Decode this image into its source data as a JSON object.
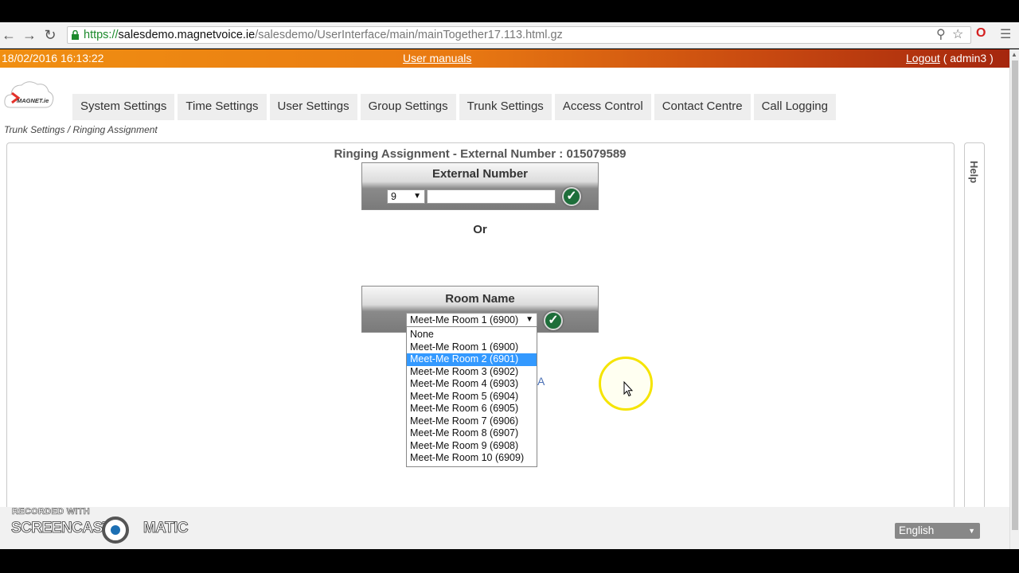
{
  "browser": {
    "url_protocol": "https://",
    "url_host": "salesdemo.magnetvoice.ie",
    "url_path": "/salesdemo/UserInterface/main/mainTogether17.113.html.gz"
  },
  "topbar": {
    "datetime": "18/02/2016  16:13:22",
    "user_manuals": "User manuals",
    "logout": "Logout",
    "user": " ( admin3 )"
  },
  "logo": {
    "text": "MAGNET.ie"
  },
  "menu": [
    "System Settings",
    "Time Settings",
    "User Settings",
    "Group Settings",
    "Trunk Settings",
    "Access Control",
    "Contact Centre",
    "Call Logging"
  ],
  "breadcrumb": "Trunk Settings / Ringing Assignment",
  "help_tab": "Help",
  "ringing": {
    "title": "Ringing Assignment - External Number : 015079589",
    "external_header": "External Number",
    "prefix_value": "9",
    "external_value": "",
    "or_label": "Or",
    "room_header": "Room Name",
    "room_value": "Meet-Me Room 1 (6900)",
    "room_options": [
      "None",
      "Meet-Me Room 1 (6900)",
      "Meet-Me Room 2 (6901)",
      "Meet-Me Room 3 (6902)",
      "Meet-Me Room 4 (6903)",
      "Meet-Me Room 5 (6904)",
      "Meet-Me Room 6 (6905)",
      "Meet-Me Room 7 (6906)",
      "Meet-Me Room 8 (6907)",
      "Meet-Me Room 9 (6908)",
      "Meet-Me Room 10 (6909)"
    ],
    "highlighted_option": "Meet-Me Room 2 (6901)",
    "partial_link": "A"
  },
  "footer": {
    "watermark_line1": "RECORDED WITH",
    "watermark_brand1": "SCREENCAST",
    "watermark_brand2": "MATIC",
    "language": "English"
  },
  "colors": {
    "topbar_start": "#f08f12",
    "topbar_end": "#a5260e",
    "check_green": "#1e6e3a",
    "highlight_blue": "#3399ff"
  }
}
